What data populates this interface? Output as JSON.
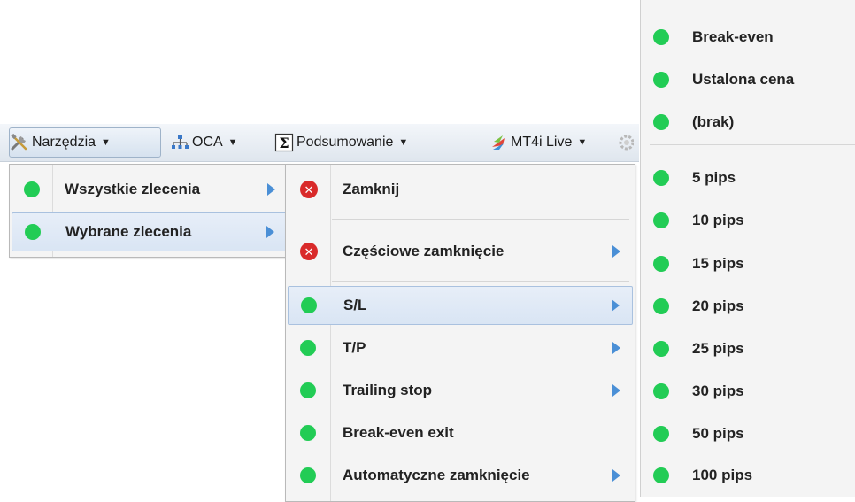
{
  "toolbar": {
    "items": [
      {
        "label": "Narzędzia",
        "icon": "tools-icon",
        "active": true
      },
      {
        "label": "OCA",
        "icon": "hierarchy-icon"
      },
      {
        "label": "Podsumowanie",
        "icon": "sigma-icon"
      },
      {
        "label": "MT4i Live",
        "icon": "mt4-logo-icon"
      }
    ]
  },
  "menu1": {
    "items": [
      {
        "label": "Wszystkie zlecenia"
      },
      {
        "label": "Wybrane zlecenia",
        "highlighted": true
      }
    ]
  },
  "menu2": {
    "items": [
      {
        "label": "Zamknij",
        "icon": "close-icon"
      },
      {
        "label": "Częściowe zamknięcie",
        "icon": "close-icon",
        "submenu": true
      },
      {
        "label": "S/L",
        "highlighted": true,
        "submenu": true
      },
      {
        "label": "T/P",
        "submenu": true
      },
      {
        "label": "Trailing stop",
        "submenu": true
      },
      {
        "label": "Break-even exit"
      },
      {
        "label": "Automatyczne zamknięcie",
        "submenu": true
      }
    ]
  },
  "menu3": {
    "top_items": [
      {
        "label": "Break-even"
      },
      {
        "label": "Ustalona cena"
      },
      {
        "label": "(brak)"
      }
    ],
    "pip_items": [
      {
        "label": "5 pips"
      },
      {
        "label": "10 pips"
      },
      {
        "label": "15 pips"
      },
      {
        "label": "20 pips"
      },
      {
        "label": "25 pips"
      },
      {
        "label": "30 pips"
      },
      {
        "label": "50 pips"
      },
      {
        "label": "100 pips"
      }
    ]
  },
  "colors": {
    "status_dot": "#22cc55",
    "close_icon": "#d92a2a",
    "submenu_arrow": "#4a8fd6",
    "highlight": "#d9e5f4"
  }
}
